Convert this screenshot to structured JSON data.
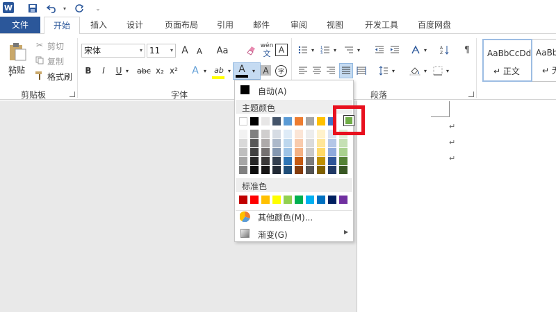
{
  "qat": {
    "logo": "W"
  },
  "tabs": {
    "file": "文件",
    "home": "开始",
    "insert": "插入",
    "design": "设计",
    "layout": "页面布局",
    "references": "引用",
    "mailings": "邮件",
    "review": "审阅",
    "view": "视图",
    "developer": "开发工具",
    "baidu": "百度网盘"
  },
  "clipboard": {
    "paste": "粘贴",
    "cut": "剪切",
    "copy": "复制",
    "format_painter": "格式刷",
    "group_label": "剪贴板"
  },
  "font": {
    "font_name": "宋体",
    "font_size": "11",
    "grow": "A",
    "shrink": "A",
    "change_case": "Aa",
    "phonetic_top": "wén",
    "phonetic_bottom": "文",
    "char_border": "A",
    "bold": "B",
    "italic": "I",
    "underline": "U",
    "strike": "abc",
    "subscript": "x₂",
    "superscript": "x²",
    "text_effect": "A",
    "highlight": "ab",
    "font_color": "A",
    "char_shading": "A",
    "enclose": "字",
    "group_label": "字体"
  },
  "paragraph": {
    "group_label": "段落"
  },
  "styles": {
    "normal_preview": "AaBbCcDd",
    "normal_name": "↵ 正文",
    "nospace_preview": "AaBb",
    "nospace_name": "↵ 无"
  },
  "color_menu": {
    "auto": "自动(A)",
    "theme_header": "主题颜色",
    "standard_header": "标准色",
    "more_colors": "其他颜色(M)...",
    "gradient": "渐变(G)",
    "theme_top": [
      "#ffffff",
      "#000000",
      "#e7e6e6",
      "#44546a",
      "#5b9bd5",
      "#ed7d31",
      "#a5a5a5",
      "#ffc000",
      "#4472c4",
      "#70ad47"
    ],
    "theme_shades": [
      [
        "#f2f2f2",
        "#d9d9d9",
        "#bfbfbf",
        "#a6a6a6",
        "#808080"
      ],
      [
        "#808080",
        "#595959",
        "#404040",
        "#262626",
        "#0d0d0d"
      ],
      [
        "#d0cece",
        "#aeaaaa",
        "#757171",
        "#3a3838",
        "#171616"
      ],
      [
        "#d6dce4",
        "#adb9ca",
        "#8497b0",
        "#333f4f",
        "#222a35"
      ],
      [
        "#deebf7",
        "#bdd7ee",
        "#9dc3e6",
        "#2e75b6",
        "#1f4e79"
      ],
      [
        "#fbe5d6",
        "#f8cbad",
        "#f4b183",
        "#c55a11",
        "#843c0c"
      ],
      [
        "#ededed",
        "#dbdbdb",
        "#c9c9c9",
        "#7b7b7b",
        "#525252"
      ],
      [
        "#fff2cc",
        "#ffe699",
        "#ffd966",
        "#bf9000",
        "#7f6000"
      ],
      [
        "#dae3f3",
        "#b4c7e7",
        "#8faadc",
        "#2f5597",
        "#203864"
      ],
      [
        "#e2f0d9",
        "#c5e0b4",
        "#a9d18e",
        "#548235",
        "#385723"
      ]
    ],
    "standard": [
      "#c00000",
      "#ff0000",
      "#ffc000",
      "#ffff00",
      "#92d050",
      "#00b050",
      "#00b0f0",
      "#0070c0",
      "#002060",
      "#7030a0"
    ],
    "highlighted_color": "#70ad47"
  },
  "doc": {
    "para_mark": "↵"
  }
}
